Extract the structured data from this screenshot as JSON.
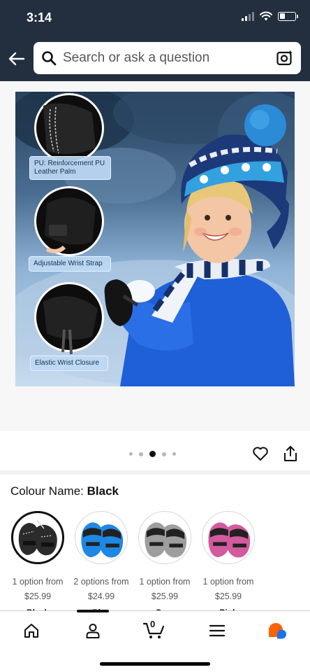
{
  "status_bar": {
    "time": "3:14"
  },
  "header": {
    "search_placeholder": "Search or ask a question",
    "icons": [
      "back-arrow-icon",
      "search-icon",
      "camera-scan-icon"
    ]
  },
  "product_image": {
    "callouts": [
      {
        "label_line1": "PU: Reinforcement PU",
        "label_line2": "Leather Palm"
      },
      {
        "label_line1": "Adjustable Wrist Strap",
        "label_line2": ""
      },
      {
        "label_line1": "Elastic Wrist Closure",
        "label_line2": ""
      }
    ],
    "carousel": {
      "total": 5,
      "active_index": 2
    }
  },
  "actions": {
    "icons": [
      "heart-icon",
      "share-icon"
    ]
  },
  "colour": {
    "label": "Colour Name: ",
    "selected": "Black",
    "options": [
      {
        "options_text": "1 option from",
        "price": "$25.99",
        "name": "Black",
        "color": "#2b2b2b",
        "selected": true
      },
      {
        "options_text": "2 options from",
        "price": "$24.99",
        "name": "Blue",
        "color": "#1e88e5",
        "selected": false
      },
      {
        "options_text": "1 option from",
        "price": "$25.99",
        "name": "Grey",
        "color": "#9e9e9e",
        "selected": false
      },
      {
        "options_text": "1 option from",
        "price": "$25.99",
        "name": "Pink",
        "color": "#d45a9e",
        "selected": false
      }
    ]
  },
  "bottom_nav": {
    "cart_count": "0",
    "icons": [
      "home-icon",
      "account-icon",
      "cart-icon",
      "menu-icon",
      "ai-assistant-icon"
    ]
  },
  "colors": {
    "header_bg": "#232f3e",
    "accent_orange": "#ff6200",
    "accent_blue": "#1a73e8"
  }
}
